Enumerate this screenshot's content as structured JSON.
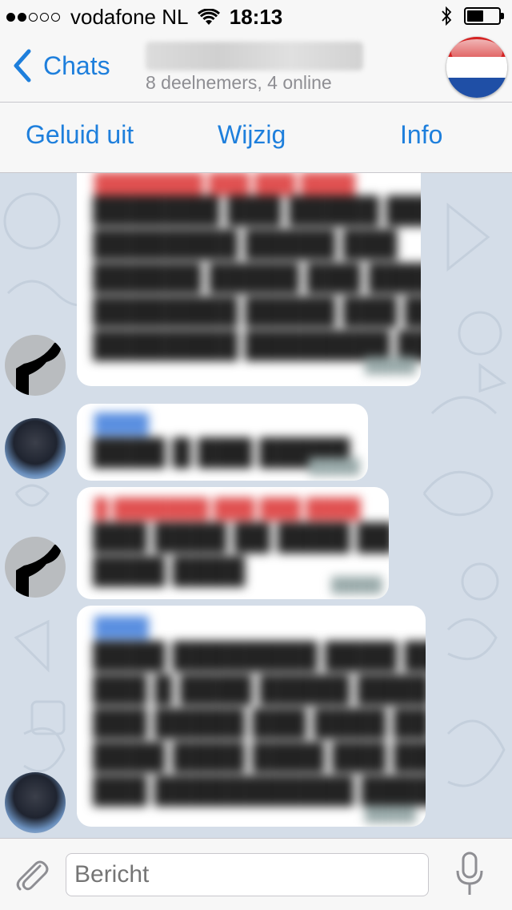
{
  "status_bar": {
    "carrier": "vodafone NL",
    "time": "18:13",
    "signal_bars": 2,
    "signal_total": 5,
    "battery_level": 0.55
  },
  "nav": {
    "back_label": "Chats",
    "subtitle": "8 deelnemers, 4 online"
  },
  "actions": {
    "mute": "Geluid uit",
    "edit": "Wijzig",
    "info": "Info"
  },
  "composer": {
    "placeholder": "Bericht"
  },
  "colors": {
    "accent": "#1e7fdc",
    "chat_background": "#d4dde8"
  },
  "icons": [
    "back-chevron-icon",
    "wifi-icon",
    "bluetooth-icon",
    "battery-icon",
    "attach-icon",
    "microphone-icon"
  ]
}
